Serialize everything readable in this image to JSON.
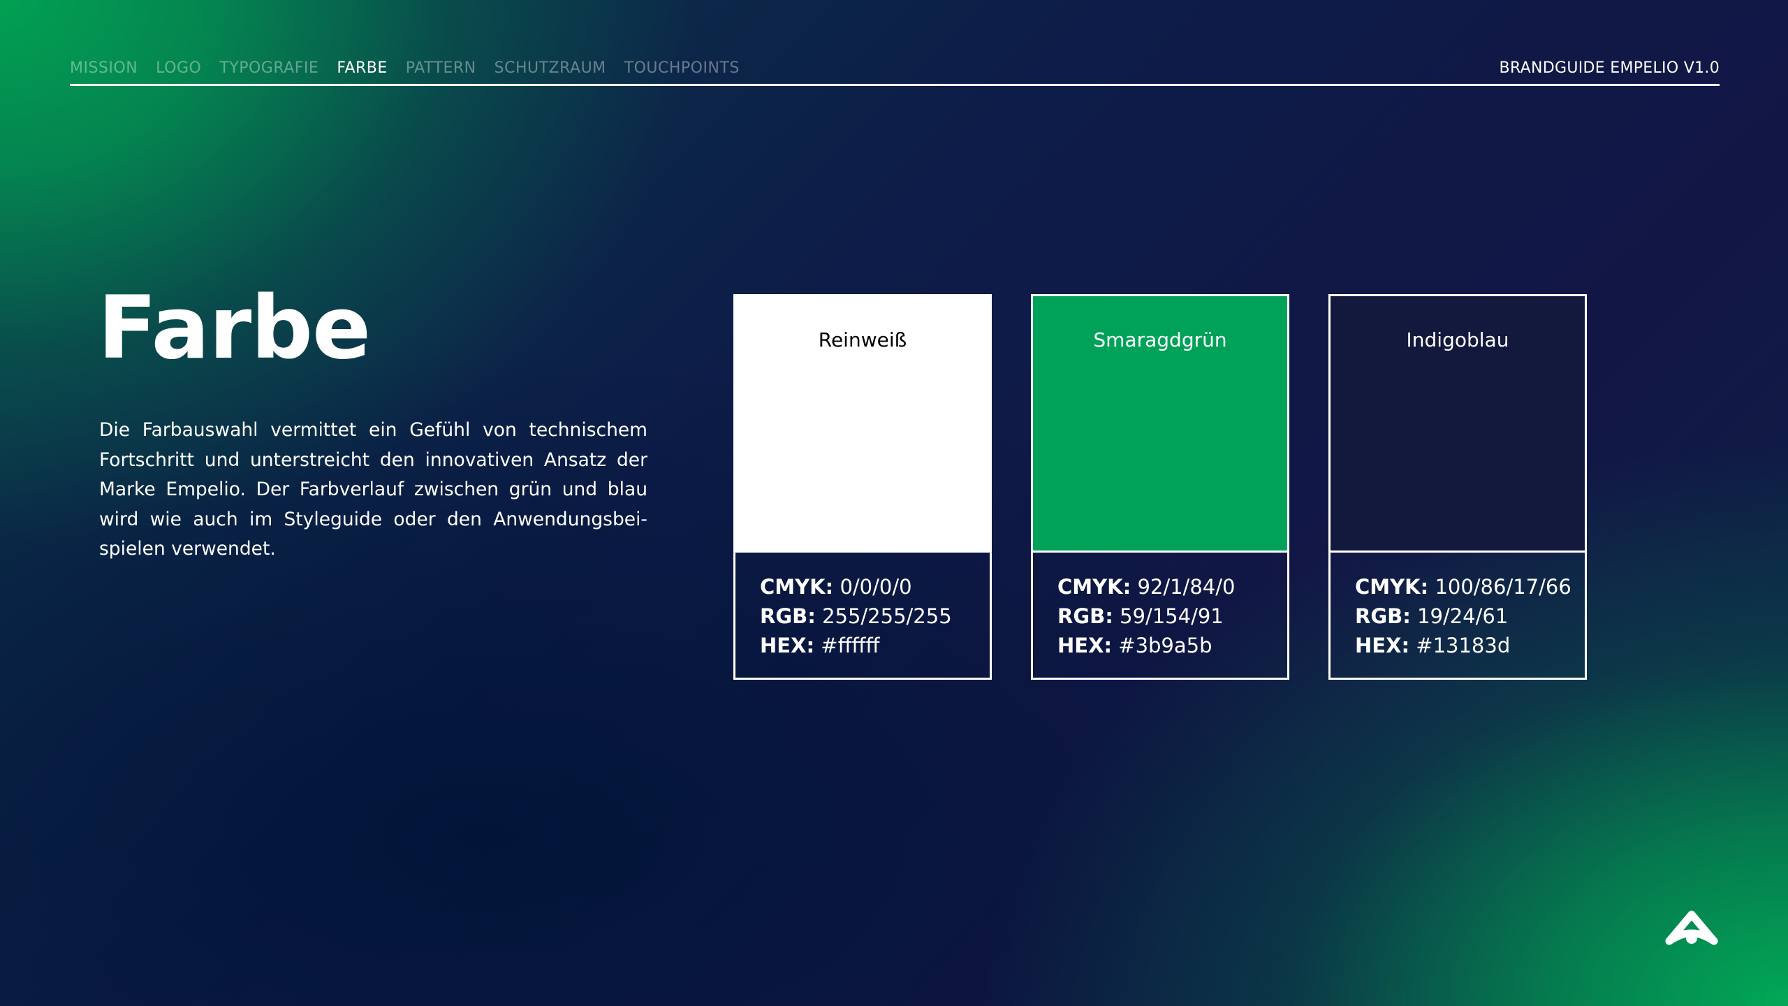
{
  "nav": {
    "items": [
      {
        "label": "MISSION",
        "active": false
      },
      {
        "label": "LOGO",
        "active": false
      },
      {
        "label": "TYPOGRAFIE",
        "active": false
      },
      {
        "label": "FARBE",
        "active": true
      },
      {
        "label": "PATTERN",
        "active": false
      },
      {
        "label": "SCHUTZRAUM",
        "active": false
      },
      {
        "label": "TOUCHPOINTS",
        "active": false
      }
    ],
    "brand": "BRANDGUIDE EMPELIO V1.0"
  },
  "page": {
    "title": "Farbe",
    "body": "Die Farbauswahl vermittet ein Gefühl von  technischem Fortschritt und unterstreicht den innovativen Ansatz der Marke Empelio. Der Farbverlauf zwischen grün und blau wird wie auch im Styleguide oder den Anwendungsbei-spielen verwendet."
  },
  "swatches": [
    {
      "name": "Reinweiß",
      "fill": "#ffffff",
      "name_color": "#000000",
      "cmyk_label": "CMYK:",
      "cmyk": "0/0/0/0",
      "rgb_label": "RGB:",
      "rgb": "255/255/255",
      "hex_label": "HEX:",
      "hex": "#ffffff"
    },
    {
      "name": "Smaragdgrün",
      "fill": "#00a159",
      "name_color": "#ffffff",
      "cmyk_label": "CMYK:",
      "cmyk": "92/1/84/0",
      "rgb_label": "RGB:",
      "rgb": "59/154/91",
      "hex_label": "HEX:",
      "hex": "#3b9a5b"
    },
    {
      "name": "Indigoblau",
      "fill": "#13183d",
      "name_color": "#ffffff",
      "cmyk_label": "CMYK:",
      "cmyk": "100/86/17/66",
      "rgb_label": "RGB:",
      "rgb": "19/24/61",
      "hex_label": "HEX:",
      "hex": "#13183d"
    }
  ],
  "logo": {
    "icon": "empelio-logo-icon"
  }
}
